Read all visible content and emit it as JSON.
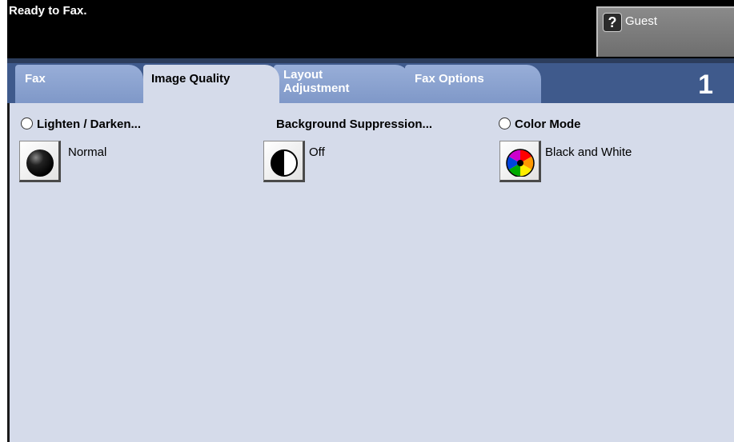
{
  "status": {
    "message": "Ready to Fax."
  },
  "user": {
    "label": "Guest",
    "icon": "help-icon"
  },
  "tabs": [
    {
      "label": "Fax",
      "active": false
    },
    {
      "label": "Image Quality",
      "active": true
    },
    {
      "label": "Layout\nAdjustment",
      "active": false
    },
    {
      "label": "Fax Options",
      "active": false
    }
  ],
  "page_number": "1",
  "sections": {
    "lighten": {
      "title": "Lighten / Darken...",
      "value": "Normal",
      "icon": "lighten-darken-icon"
    },
    "background": {
      "title": "Background Suppression...",
      "value": "Off",
      "icon": "background-suppression-icon"
    },
    "color": {
      "title": "Color Mode",
      "value": "Black and White",
      "icon": "color-wheel-icon"
    }
  },
  "colors": {
    "header_bg": "#000000",
    "tab_active": "#d5dbea",
    "tab_inactive": "#8aa2d0",
    "tab_bar": "#3f5a8c",
    "content_bg": "#d5dbea"
  }
}
